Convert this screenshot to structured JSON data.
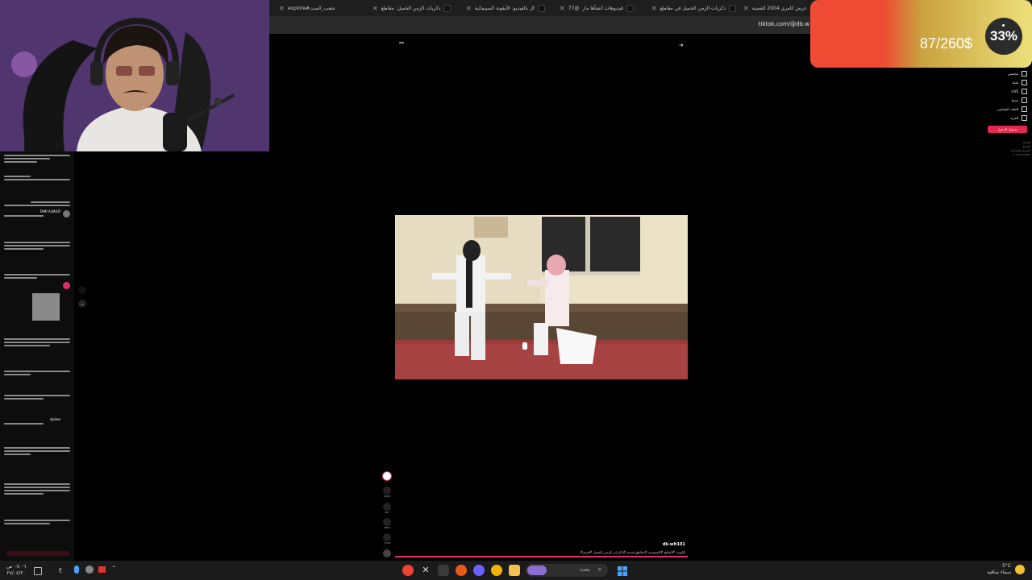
{
  "browser": {
    "tabs": [
      {
        "title": "عرض كامري 2004 الفضية"
      },
      {
        "title": "ذكريات الزمن الجميل في مقاطع"
      },
      {
        "title": "فيديوهات أنشأها مار"
      },
      {
        "title": "77@"
      },
      {
        "title": "ال بالفيديو: الأيقونة السينمائية"
      },
      {
        "title": "ذكريات الزمن الجميل: مقاطع"
      },
      {
        "title": "explore#شعب_الصت"
      }
    ],
    "url": "tiktok.com/@db.w"
  },
  "donation": {
    "amount": "87/260$",
    "percent": "33%",
    "progress": 0.33,
    "colors": {
      "left": "#ef4b35",
      "right": "#ece07a"
    }
  },
  "right_nav": {
    "items": [
      "مخصص",
      "لقبك",
      "LIVE",
      "نشط",
      "الملف الشخصي",
      "المزيد"
    ],
    "login": "تسجيل الدخول",
    "footer": [
      "الشركة",
      "البرنامج",
      "الشروط والسياسات",
      "© 2025 TikTok"
    ]
  },
  "comments": {
    "names": [
      "TAMI ALMAZI",
      "dyslee"
    ]
  },
  "video": {
    "author": "db.wlt101",
    "caption": "#الكويت #الخليج #السعودية #مقاطع_قديمة #ذكريات_الزمن_الجميل #قديم",
    "counts": [
      "5938",
      "497",
      "4870",
      "7118"
    ]
  },
  "taskbar": {
    "clock": "٠٧:٠٦ ص",
    "date": "٢٧/٠٤/٢٠",
    "weather_temp": "5°C",
    "weather_desc": "سماء صافية",
    "search": "بحث",
    "lang": "ع"
  }
}
